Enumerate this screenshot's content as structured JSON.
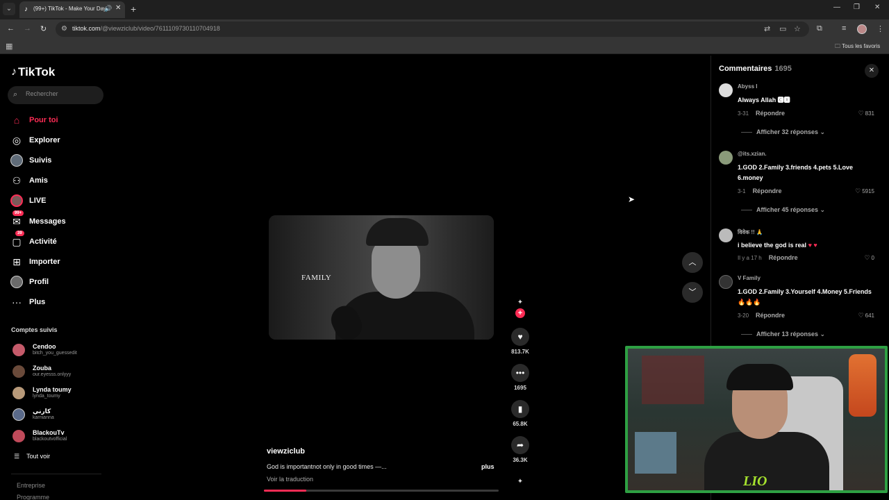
{
  "browser": {
    "tab_title": "(99+) TikTok - Make Your Day",
    "url_domain": "tiktok.com",
    "url_path": "/@viewziclub/video/7611109730110704918",
    "bookmarks_folder": "Tous les favoris"
  },
  "sidebar": {
    "logo": "TikTok",
    "search_placeholder": "Rechercher",
    "nav": [
      {
        "label": "Pour toi",
        "icon": "home-icon",
        "active": true
      },
      {
        "label": "Explorer",
        "icon": "compass-icon"
      },
      {
        "label": "Suivis",
        "icon": "following-avatar-icon"
      },
      {
        "label": "Amis",
        "icon": "friends-icon"
      },
      {
        "label": "LIVE",
        "icon": "live-icon"
      },
      {
        "label": "Messages",
        "icon": "messages-icon",
        "badge": "99+"
      },
      {
        "label": "Activité",
        "icon": "activity-icon",
        "badge": "39"
      },
      {
        "label": "Importer",
        "icon": "upload-icon"
      },
      {
        "label": "Profil",
        "icon": "profile-icon"
      },
      {
        "label": "Plus",
        "icon": "more-icon"
      }
    ],
    "followed_title": "Comptes suivis",
    "followed": [
      {
        "name": "Cendoo",
        "handle": "bitch_you_guessedit",
        "color": "#c45a6a"
      },
      {
        "name": "Zouba",
        "handle": "our.eyesss.onlyyy",
        "color": "#6a4a3a"
      },
      {
        "name": "Lynda toumy",
        "handle": "lynda_toumy",
        "color": "#b89a7a"
      },
      {
        "name": "كارني",
        "handle": "karnianna",
        "color": "#5a6a8a"
      },
      {
        "name": "BlackouTv",
        "handle": "blackoutvofficial",
        "color": "#c04a5a"
      }
    ],
    "see_all": "Tout voir",
    "footer": [
      "Entreprise",
      "Programme"
    ]
  },
  "video": {
    "overlay_text": "FAMILY",
    "author": "viewziclub",
    "description": "God is importantnot only in good times —...",
    "more": "plus",
    "translate": "Voir la traduction",
    "progress": 0.18,
    "likes": "813.7K",
    "comments": "1695",
    "saves": "65.8K",
    "shares": "36.3K"
  },
  "comments": {
    "title": "Commentaires",
    "count": "1695",
    "items": [
      {
        "user": "Abyss I",
        "text": "Always Allah 🅲🆇",
        "date": "3-31",
        "reply": "Répondre",
        "likes": "831",
        "thread": "Afficher 32 réponses",
        "avatar": "#ddd"
      },
      {
        "user": "@its.xzian.",
        "text": "1.GOD 2.Family 3.friends 4.pets 5.Love 6.money",
        "date": "3-1",
        "reply": "Répondre",
        "likes": "5915",
        "thread": "Afficher 45 réponses",
        "avatar": "#8a9a7a"
      },
      {
        "user": "विवेक !! 🙏",
        "text": "i believe the god is real",
        "date": "Il y a 17 h",
        "reply": "Répondre",
        "likes": "0",
        "thread": "",
        "avatar": "#bbb"
      },
      {
        "user": "V Family",
        "text": "1.GOD 2.Family 3.Yourself 4.Money 5.Friends 🔥🔥🔥",
        "date": "3-20",
        "reply": "Répondre",
        "likes": "641",
        "thread": "Afficher 13 réponses",
        "avatar": "#333"
      }
    ]
  },
  "webcam": {
    "logo": "LIO"
  }
}
